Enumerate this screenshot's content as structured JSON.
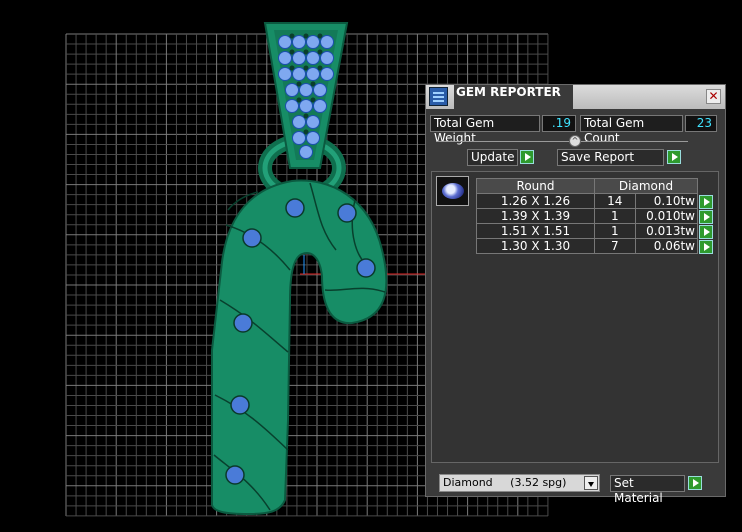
{
  "panel": {
    "title": "GEM REPORTER",
    "close_label": "✕",
    "total_weight_label": "Total Gem Weight",
    "total_weight_value": ".19",
    "total_count_label": "Total Gem Count",
    "total_count_value": "23",
    "update_label": "Update",
    "save_report_label": "Save Report",
    "table": {
      "header_shape": "Round",
      "header_material": "Diamond",
      "rows": [
        {
          "size": "1.26 X 1.26",
          "count": "14",
          "weight": "0.10tw"
        },
        {
          "size": "1.39 X 1.39",
          "count": "1",
          "weight": "0.010tw"
        },
        {
          "size": "1.51 X 1.51",
          "count": "1",
          "weight": "0.013tw"
        },
        {
          "size": "1.30 X 1.30",
          "count": "7",
          "weight": "0.06tw"
        }
      ]
    },
    "material_name": "Diamond",
    "material_spg": "(3.52 spg)",
    "set_material_label": "Set Material"
  },
  "colors": {
    "metal": "#1a8a64",
    "metal_dark": "#0b4f36",
    "gem": "#4a7bd8",
    "grid": "#555555",
    "value_text": "#3fe3ff"
  }
}
